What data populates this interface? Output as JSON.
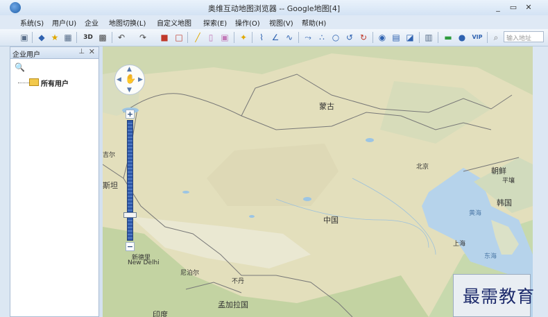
{
  "window": {
    "title": "奥维互动地图浏览器 -- Google地图[4]",
    "minimize_glyph": "_",
    "maximize_glyph": "▭",
    "close_glyph": "✕"
  },
  "menu": [
    "系统(S)",
    "用户(U)",
    "企业",
    "地图切换(L)",
    "自定义地图",
    "探索(E)",
    "操作(O)",
    "视图(V)",
    "帮助(H)"
  ],
  "toolbar": {
    "label_3d": "3D",
    "label_vip": "VIP",
    "search_placeholder": "输入地址",
    "icons": [
      "save-icon",
      "layers-icon",
      "favorite-star-icon",
      "building-icon",
      "3d-icon",
      "qr-code-icon",
      "undo-icon",
      "redo-icon",
      "delete-icon",
      "select-rect-icon",
      "pencil-icon",
      "ruler-icon",
      "screenshot-icon",
      "star-marker-icon",
      "polyline-icon",
      "angle-icon",
      "curve-icon",
      "route-icon",
      "scatter-icon",
      "circle-icon",
      "rotate-icon",
      "refresh-icon",
      "globe-icon",
      "image-icon",
      "eraser-icon",
      "export-icon",
      "chat-icon",
      "info-icon",
      "vip-icon",
      "search-icon"
    ]
  },
  "panel": {
    "title": "企业用户",
    "pin_glyph": "⊥",
    "close_glyph": "✕",
    "search_icon": "🔍",
    "tree": [
      {
        "label": "所有用户"
      }
    ]
  },
  "map": {
    "zoom_level_fraction": 0.21,
    "labels": {
      "mongolia": "蒙古",
      "beijing": "北京",
      "korea_north": "朝鲜",
      "pyongyang": "平壤",
      "korea_south": "韩国",
      "yellow_sea": "黄海",
      "shanghai": "上海",
      "east_sea": "东海",
      "china": "中国",
      "kyrgyz": "吉尔",
      "stan": "斯坦",
      "delhi_cn": "新德里",
      "delhi_en": "New Delhi",
      "nepal": "尼泊尔",
      "bhutan": "不丹",
      "bangladesh": "孟加拉国",
      "india": "印度"
    }
  },
  "watermark": "最需教育"
}
